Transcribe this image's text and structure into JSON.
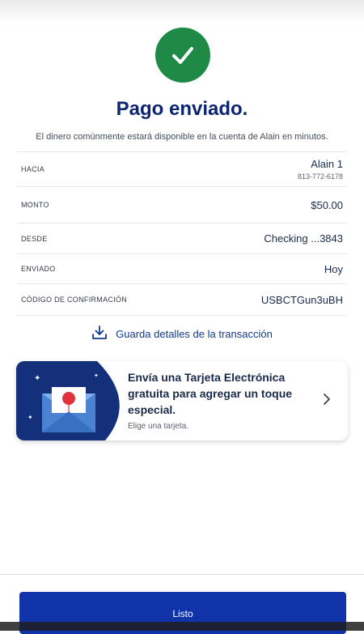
{
  "header": {
    "title": "Pago enviado.",
    "subtitle": "El dinero comúnmente estará disponible en la cuenta de Alain en minutos."
  },
  "details": [
    {
      "label": "HACIA",
      "value": "Alain 1",
      "sub": "813-772-6178"
    },
    {
      "label": "MONTO",
      "value": "$50.00"
    },
    {
      "label": "DESDE",
      "value": "Checking ...3843"
    },
    {
      "label": "ENVIADO",
      "value": "Hoy"
    },
    {
      "label": "CÓDIGO DE CONFIRMACIÓN",
      "value": "USBCTGun3uBH"
    }
  ],
  "save_link": {
    "label": "Guarda detalles de la transacción",
    "icon": "download-icon"
  },
  "promo_card": {
    "title": "Envía una Tarjeta Electrónica gratuita para agregar un toque especial.",
    "subtitle": "Elige una tarjeta.",
    "icon": "chevron-right-icon"
  },
  "footer": {
    "button_label": "Listo"
  },
  "colors": {
    "success": "#1f8a45",
    "primary": "#1133a9",
    "title": "#0d2470",
    "card_art": "#14307a"
  }
}
